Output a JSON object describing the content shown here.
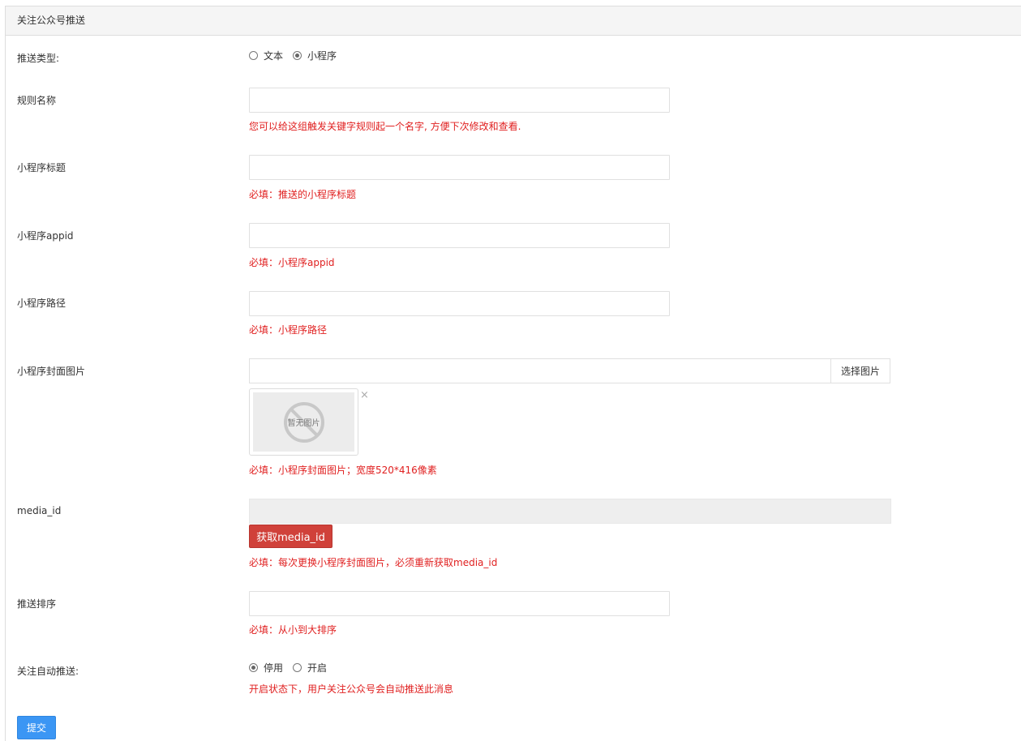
{
  "panel": {
    "title": "关注公众号推送"
  },
  "push_type": {
    "label": "推送类型:",
    "options": [
      {
        "label": "文本",
        "checked": false
      },
      {
        "label": "小程序",
        "checked": true
      }
    ]
  },
  "rule_name": {
    "label": "规则名称",
    "value": "",
    "help": "您可以给这组触发关键字规则起一个名字, 方便下次修改和查看."
  },
  "mini_title": {
    "label": "小程序标题",
    "value": "",
    "help": "必填：推送的小程序标题"
  },
  "mini_appid": {
    "label": "小程序appid",
    "value": "",
    "help": "必填：小程序appid"
  },
  "mini_path": {
    "label": "小程序路径",
    "value": "",
    "help": "必填：小程序路径"
  },
  "cover": {
    "label": "小程序封面图片",
    "value": "",
    "select_button": "选择图片",
    "placeholder_text": "暂无图片",
    "close_glyph": "×",
    "help": "必填：小程序封面图片；宽度520*416像素"
  },
  "media": {
    "label": "media_id",
    "value": "",
    "button": "获取media_id",
    "help": "必填：每次更换小程序封面图片，必须重新获取media_id"
  },
  "sort": {
    "label": "推送排序",
    "value": "",
    "help": "必填：从小到大排序"
  },
  "auto_push": {
    "label": "关注自动推送:",
    "options": [
      {
        "label": "停用",
        "checked": true
      },
      {
        "label": "开启",
        "checked": false
      }
    ],
    "help": "开启状态下，用户关注公众号会自动推送此消息"
  },
  "submit": {
    "label": "提交"
  },
  "colors": {
    "help_text": "#e02020",
    "danger_button": "#d0413a",
    "primary_button": "#3b96f4",
    "panel_heading": "#f5f5f5"
  }
}
